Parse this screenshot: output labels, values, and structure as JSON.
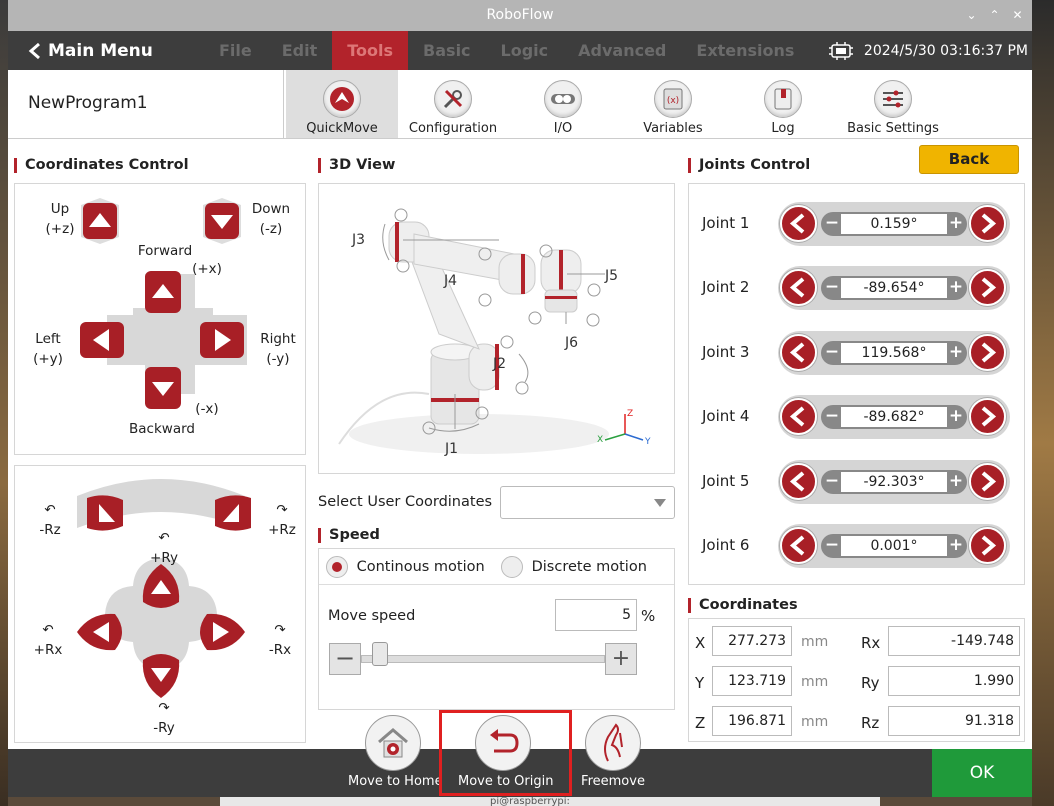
{
  "window": {
    "title": "RoboFlow"
  },
  "menu": {
    "main_menu": "Main Menu",
    "items": [
      "File",
      "Edit",
      "Tools",
      "Basic",
      "Logic",
      "Advanced",
      "Extensions"
    ],
    "active": "Tools",
    "datetime": "2024/5/30 03:16:37 PM"
  },
  "program": {
    "name": "NewProgram1"
  },
  "tools": [
    {
      "label": "QuickMove",
      "icon": "quickmove-icon"
    },
    {
      "label": "Configuration",
      "icon": "wrench-screwdriver-icon"
    },
    {
      "label": "I/O",
      "icon": "io-icon"
    },
    {
      "label": "Variables",
      "icon": "variables-icon"
    },
    {
      "label": "Log",
      "icon": "log-book-icon"
    },
    {
      "label": "Basic Settings",
      "icon": "sliders-icon"
    }
  ],
  "coords_control": {
    "title": "Coordinates Control",
    "up": "Up",
    "up_axis": "(+z)",
    "down": "Down",
    "down_axis": "(-z)",
    "forward": "Forward",
    "forward_axis": "(+x)",
    "backward": "Backward",
    "backward_axis": "(-x)",
    "left": "Left",
    "left_axis": "(+y)",
    "right": "Right",
    "right_axis": "(-y)"
  },
  "rotation_control": {
    "minus_rz": "-Rz",
    "plus_rz": "+Rz",
    "plus_ry": "+Ry",
    "minus_ry": "-Ry",
    "plus_rx": "+Rx",
    "minus_rx": "-Rx"
  },
  "view3d": {
    "title": "3D View",
    "joints": [
      "J1",
      "J2",
      "J3",
      "J4",
      "J5",
      "J6"
    ],
    "axes": {
      "x": "X",
      "y": "Y",
      "z": "Z"
    }
  },
  "user_coords": {
    "label": "Select User Coordinates",
    "value": ""
  },
  "speed": {
    "title": "Speed",
    "continuous": "Continous motion",
    "discrete": "Discrete motion",
    "mode": "continuous",
    "move_speed_label": "Move speed",
    "move_speed": "5",
    "unit": "%",
    "slider_fraction": 0.05
  },
  "joints_control": {
    "title": "Joints Control",
    "back": "Back",
    "joints": [
      {
        "name": "Joint 1",
        "value": "0.159°"
      },
      {
        "name": "Joint 2",
        "value": "-89.654°"
      },
      {
        "name": "Joint 3",
        "value": "119.568°"
      },
      {
        "name": "Joint 4",
        "value": "-89.682°"
      },
      {
        "name": "Joint 5",
        "value": "-92.303°"
      },
      {
        "name": "Joint 6",
        "value": "0.001°"
      }
    ]
  },
  "coordinates": {
    "title": "Coordinates",
    "x_label": "X",
    "x": "277.273",
    "y_label": "Y",
    "y": "123.719",
    "z_label": "Z",
    "z": "196.871",
    "rx_label": "Rx",
    "rx": "-149.748",
    "ry_label": "Ry",
    "ry": "1.990",
    "rz_label": "Rz",
    "rz": "91.318",
    "unit": "mm"
  },
  "bottom": {
    "move_home": "Move to Home",
    "move_origin": "Move to Origin",
    "freemove": "Freemove",
    "ok": "OK"
  },
  "taskbar": {
    "text": "pi@raspberrypi:"
  },
  "colors": {
    "accent": "#b2232b",
    "ok": "#1f9a3a",
    "back": "#f0b400"
  }
}
